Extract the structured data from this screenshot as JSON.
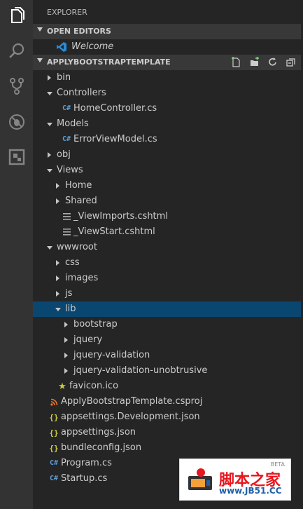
{
  "activity_bar": {
    "items": [
      {
        "name": "explorer-icon",
        "active": true
      },
      {
        "name": "search-icon",
        "active": false
      },
      {
        "name": "source-control-icon",
        "active": false
      },
      {
        "name": "debug-icon",
        "active": false
      },
      {
        "name": "extensions-icon",
        "active": false
      }
    ]
  },
  "sidebar": {
    "title": "EXPLORER",
    "open_editors": {
      "header": "OPEN EDITORS",
      "items": [
        {
          "label": "Welcome",
          "icon": "vscode-icon"
        }
      ]
    },
    "project": {
      "header": "APPLYBOOTSTRAPTEMPLATE",
      "actions": [
        "new-file-icon",
        "new-folder-icon",
        "refresh-icon",
        "collapse-all-icon"
      ],
      "tree": [
        {
          "label": "bin",
          "type": "folder",
          "state": "closed",
          "depth": 0
        },
        {
          "label": "Controllers",
          "type": "folder",
          "state": "open",
          "depth": 0
        },
        {
          "label": "HomeController.cs",
          "type": "cs",
          "depth": 1
        },
        {
          "label": "Models",
          "type": "folder",
          "state": "open",
          "depth": 0
        },
        {
          "label": "ErrorViewModel.cs",
          "type": "cs",
          "depth": 1
        },
        {
          "label": "obj",
          "type": "folder",
          "state": "closed",
          "depth": 0
        },
        {
          "label": "Views",
          "type": "folder",
          "state": "open",
          "depth": 0
        },
        {
          "label": "Home",
          "type": "folder",
          "state": "closed",
          "depth": 1
        },
        {
          "label": "Shared",
          "type": "folder",
          "state": "closed",
          "depth": 1
        },
        {
          "label": "_ViewImports.cshtml",
          "type": "lines",
          "depth": 1
        },
        {
          "label": "_ViewStart.cshtml",
          "type": "lines",
          "depth": 1
        },
        {
          "label": "wwwroot",
          "type": "folder",
          "state": "open",
          "depth": 0
        },
        {
          "label": "css",
          "type": "folder",
          "state": "closed",
          "depth": 1
        },
        {
          "label": "images",
          "type": "folder",
          "state": "closed",
          "depth": 1
        },
        {
          "label": "js",
          "type": "folder",
          "state": "closed",
          "depth": 1
        },
        {
          "label": "lib",
          "type": "folder",
          "state": "open",
          "depth": 1,
          "selected": true
        },
        {
          "label": "bootstrap",
          "type": "folder",
          "state": "closed",
          "depth": 2
        },
        {
          "label": "jquery",
          "type": "folder",
          "state": "closed",
          "depth": 2
        },
        {
          "label": "jquery-validation",
          "type": "folder",
          "state": "closed",
          "depth": 2
        },
        {
          "label": "jquery-validation-unobtrusive",
          "type": "folder",
          "state": "closed",
          "depth": 2
        },
        {
          "label": "favicon.ico",
          "type": "star",
          "depth": 0.5
        },
        {
          "label": "ApplyBootstrapTemplate.csproj",
          "type": "rss",
          "depth": -0.5
        },
        {
          "label": "appsettings.Development.json",
          "type": "json",
          "depth": -0.5
        },
        {
          "label": "appsettings.json",
          "type": "json",
          "depth": -0.5
        },
        {
          "label": "bundleconfig.json",
          "type": "json",
          "depth": -0.5
        },
        {
          "label": "Program.cs",
          "type": "cs",
          "depth": -0.5
        },
        {
          "label": "Startup.cs",
          "type": "cs",
          "depth": -0.5
        }
      ]
    }
  },
  "watermark": {
    "title": "脚本之家",
    "url": "www.JB51.CC",
    "badge": "BETA"
  },
  "colors": {
    "selection": "#094771",
    "folder_text": "#cccccc",
    "cs_icon": "#5c9fd6",
    "json_icon": "#cbcb41",
    "star_icon": "#cbcb41",
    "rss_icon": "#e37933"
  }
}
